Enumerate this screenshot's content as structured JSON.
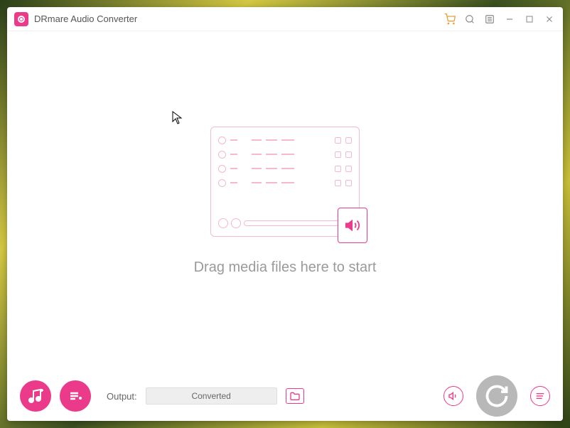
{
  "app": {
    "title": "DRmare Audio Converter"
  },
  "content": {
    "drop_hint": "Drag media files here to start"
  },
  "footer": {
    "output_label": "Output:",
    "output_value": "Converted"
  }
}
